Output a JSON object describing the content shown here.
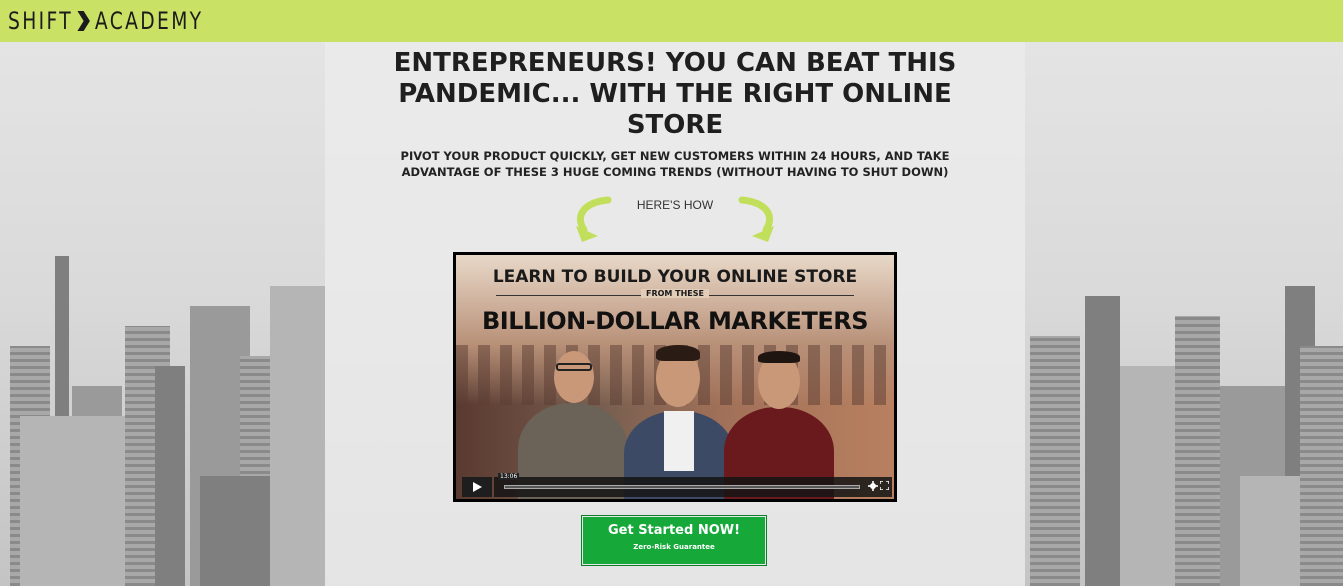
{
  "header": {
    "logo_left": "SHIFT",
    "logo_right": "ACADEMY",
    "accent_color": "#c9e265"
  },
  "main": {
    "headline": "ENTREPRENEURS! YOU CAN BEAT THIS PANDEMIC... WITH THE RIGHT ONLINE STORE",
    "subheadline": "PIVOT YOUR PRODUCT QUICKLY, GET NEW CUSTOMERS WITHIN 24 HOURS, AND TAKE ADVANTAGE OF THESE 3 HUGE COMING TRENDS (WITHOUT HAVING TO SHUT DOWN)",
    "heres_how": "HERE'S HOW"
  },
  "video": {
    "title_line1": "LEARN TO BUILD YOUR ONLINE STORE",
    "title_line2": "FROM THESE",
    "title_line3": "BILLION-DOLLAR MARKETERS",
    "duration": "13:06",
    "play_icon": "play-icon",
    "settings_icon": "gear-icon",
    "fullscreen_icon": "fullscreen-icon"
  },
  "cta": {
    "label": "Get Started NOW!",
    "sublabel": "Zero-Risk Guarantee",
    "color": "#16a93a"
  }
}
